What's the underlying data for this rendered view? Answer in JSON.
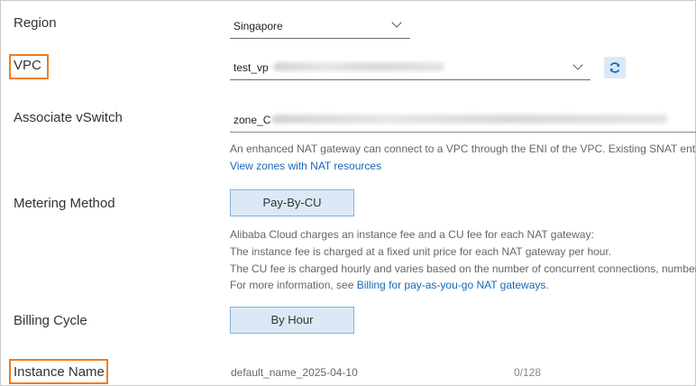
{
  "region": {
    "label": "Region",
    "value": "Singapore",
    "icon": "chevron-down-icon"
  },
  "vpc": {
    "label": "VPC",
    "value": "test_vp",
    "icon": "chevron-down-icon",
    "refresh_icon": "refresh-icon"
  },
  "vswitch": {
    "label": "Associate vSwitch",
    "value": "zone_C",
    "help": "An enhanced NAT gateway can connect to a VPC through the ENI of the VPC. Existing SNAT entri",
    "link": "View zones with NAT resources"
  },
  "metering": {
    "label": "Metering Method",
    "button": "Pay-By-CU",
    "help": [
      "Alibaba Cloud charges an instance fee and a CU fee for each NAT gateway:",
      "The instance fee is charged at a fixed unit price for each NAT gateway per hour.",
      "The CU fee is charged hourly and varies based on the number of concurrent connections, number"
    ],
    "more_prefix": "For more information, see ",
    "more_link": "Billing for pay-as-you-go NAT gateways",
    "more_suffix": "."
  },
  "billing": {
    "label": "Billing Cycle",
    "button": "By Hour"
  },
  "instance_name": {
    "label": "Instance Name",
    "value": "default_name_2025-04-10",
    "counter": "0/128"
  },
  "colors": {
    "highlight": "#f07c1d",
    "link": "#1a68b8",
    "button_bg": "#dbe9f7"
  }
}
